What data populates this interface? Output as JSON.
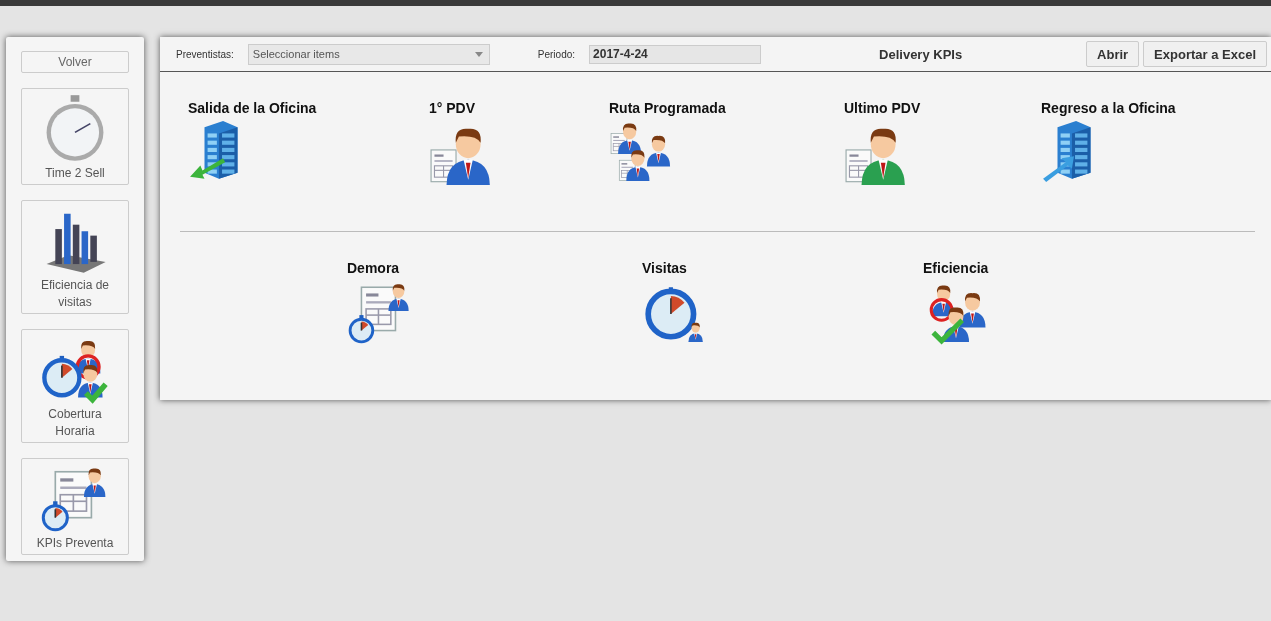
{
  "sidebar": {
    "back_button": "Volver",
    "items": [
      {
        "label": "Time 2 Sell",
        "kind": "stopwatch"
      },
      {
        "label": "Eficiencia de visitas",
        "kind": "bars"
      },
      {
        "label": "Cobertura Horaria",
        "kind": "clock-people"
      },
      {
        "label": "KPIs Preventa",
        "kind": "doc-clock-person"
      }
    ]
  },
  "toolbar": {
    "preventistas_label": "Preventistas:",
    "preventistas_placeholder": "Seleccionar items",
    "periodo_label": "Periodo:",
    "periodo_value": "2017-4-24",
    "title": "Delivery KPIs",
    "buttons": [
      "Abrir",
      "Exportar a Excel"
    ]
  },
  "kpis_top": [
    {
      "label": "Salida de la Oficina",
      "kind": "building-out"
    },
    {
      "label": "1° PDV",
      "kind": "person-doc-blue"
    },
    {
      "label": "Ruta Programada",
      "kind": "people-docs"
    },
    {
      "label": "Ultimo PDV",
      "kind": "person-doc-green"
    },
    {
      "label": "Regreso a la Oficina",
      "kind": "building-in"
    }
  ],
  "kpis_bottom": [
    {
      "label": "Demora",
      "kind": "doc-clock-person"
    },
    {
      "label": "Visitas",
      "kind": "clock-small-people"
    },
    {
      "label": "Eficiencia",
      "kind": "people-check"
    }
  ]
}
